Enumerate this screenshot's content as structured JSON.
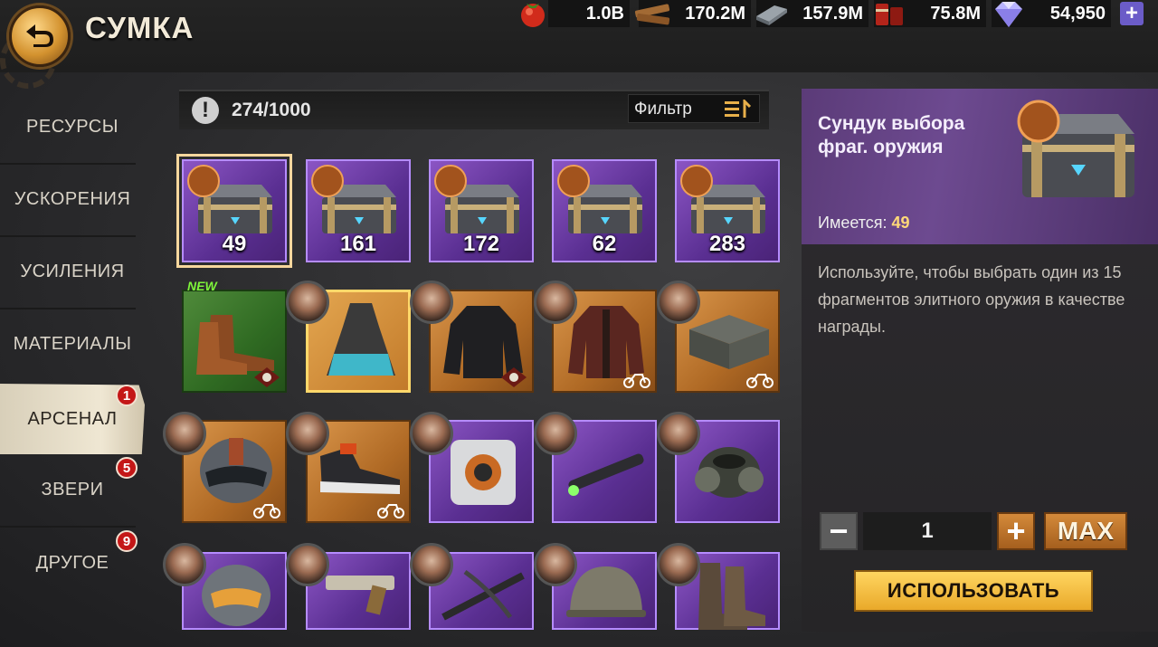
{
  "header": {
    "title": "СУМКА"
  },
  "resources": [
    {
      "icon": "tomato-icon",
      "value": "1.0B"
    },
    {
      "icon": "wood-icon",
      "value": "170.2M"
    },
    {
      "icon": "steel-icon",
      "value": "157.9M"
    },
    {
      "icon": "fuel-icon",
      "value": "75.8M"
    },
    {
      "icon": "gem-icon",
      "value": "54,950"
    }
  ],
  "sidebar": {
    "items": [
      {
        "label": "РЕСУРСЫ"
      },
      {
        "label": "УСКОРЕНИЯ"
      },
      {
        "label": "УСИЛЕНИЯ"
      },
      {
        "label": "МАТЕРИАЛЫ"
      },
      {
        "label": "АРСЕНАЛ",
        "badge": "1",
        "active": true
      },
      {
        "label": "ЗВЕРИ",
        "badge": "5"
      },
      {
        "label": "ДРУГОЕ",
        "badge": "9"
      }
    ]
  },
  "inventory": {
    "capacity": "274/1000",
    "filter_label": "Фильтр",
    "new_label": "NEW",
    "chests": [
      {
        "name": "weapon-fragment-chest",
        "count": "49"
      },
      {
        "name": "helmet-fragment-chest",
        "count": "161"
      },
      {
        "name": "vest-fragment-chest",
        "count": "172"
      },
      {
        "name": "backpack-fragment-chest",
        "count": "62"
      },
      {
        "name": "pants-fragment-chest",
        "count": "283"
      }
    ]
  },
  "details": {
    "title": "Сундук выбора фраг. оружия",
    "owned_label": "Имеется:",
    "owned_value": "49",
    "description": "Используйте, чтобы выбрать один из 15 фрагментов элитного оружия в качестве награды.",
    "quantity": "1",
    "max_label": "MAX",
    "use_label": "ИСПОЛЬЗОВАТЬ"
  },
  "colors": {
    "accent_gold": "#ffd560",
    "rarity_purple": "#8b55c4",
    "rarity_orange": "#d9954a",
    "rarity_green": "#4f8a3a",
    "badge_red": "#c41717"
  }
}
